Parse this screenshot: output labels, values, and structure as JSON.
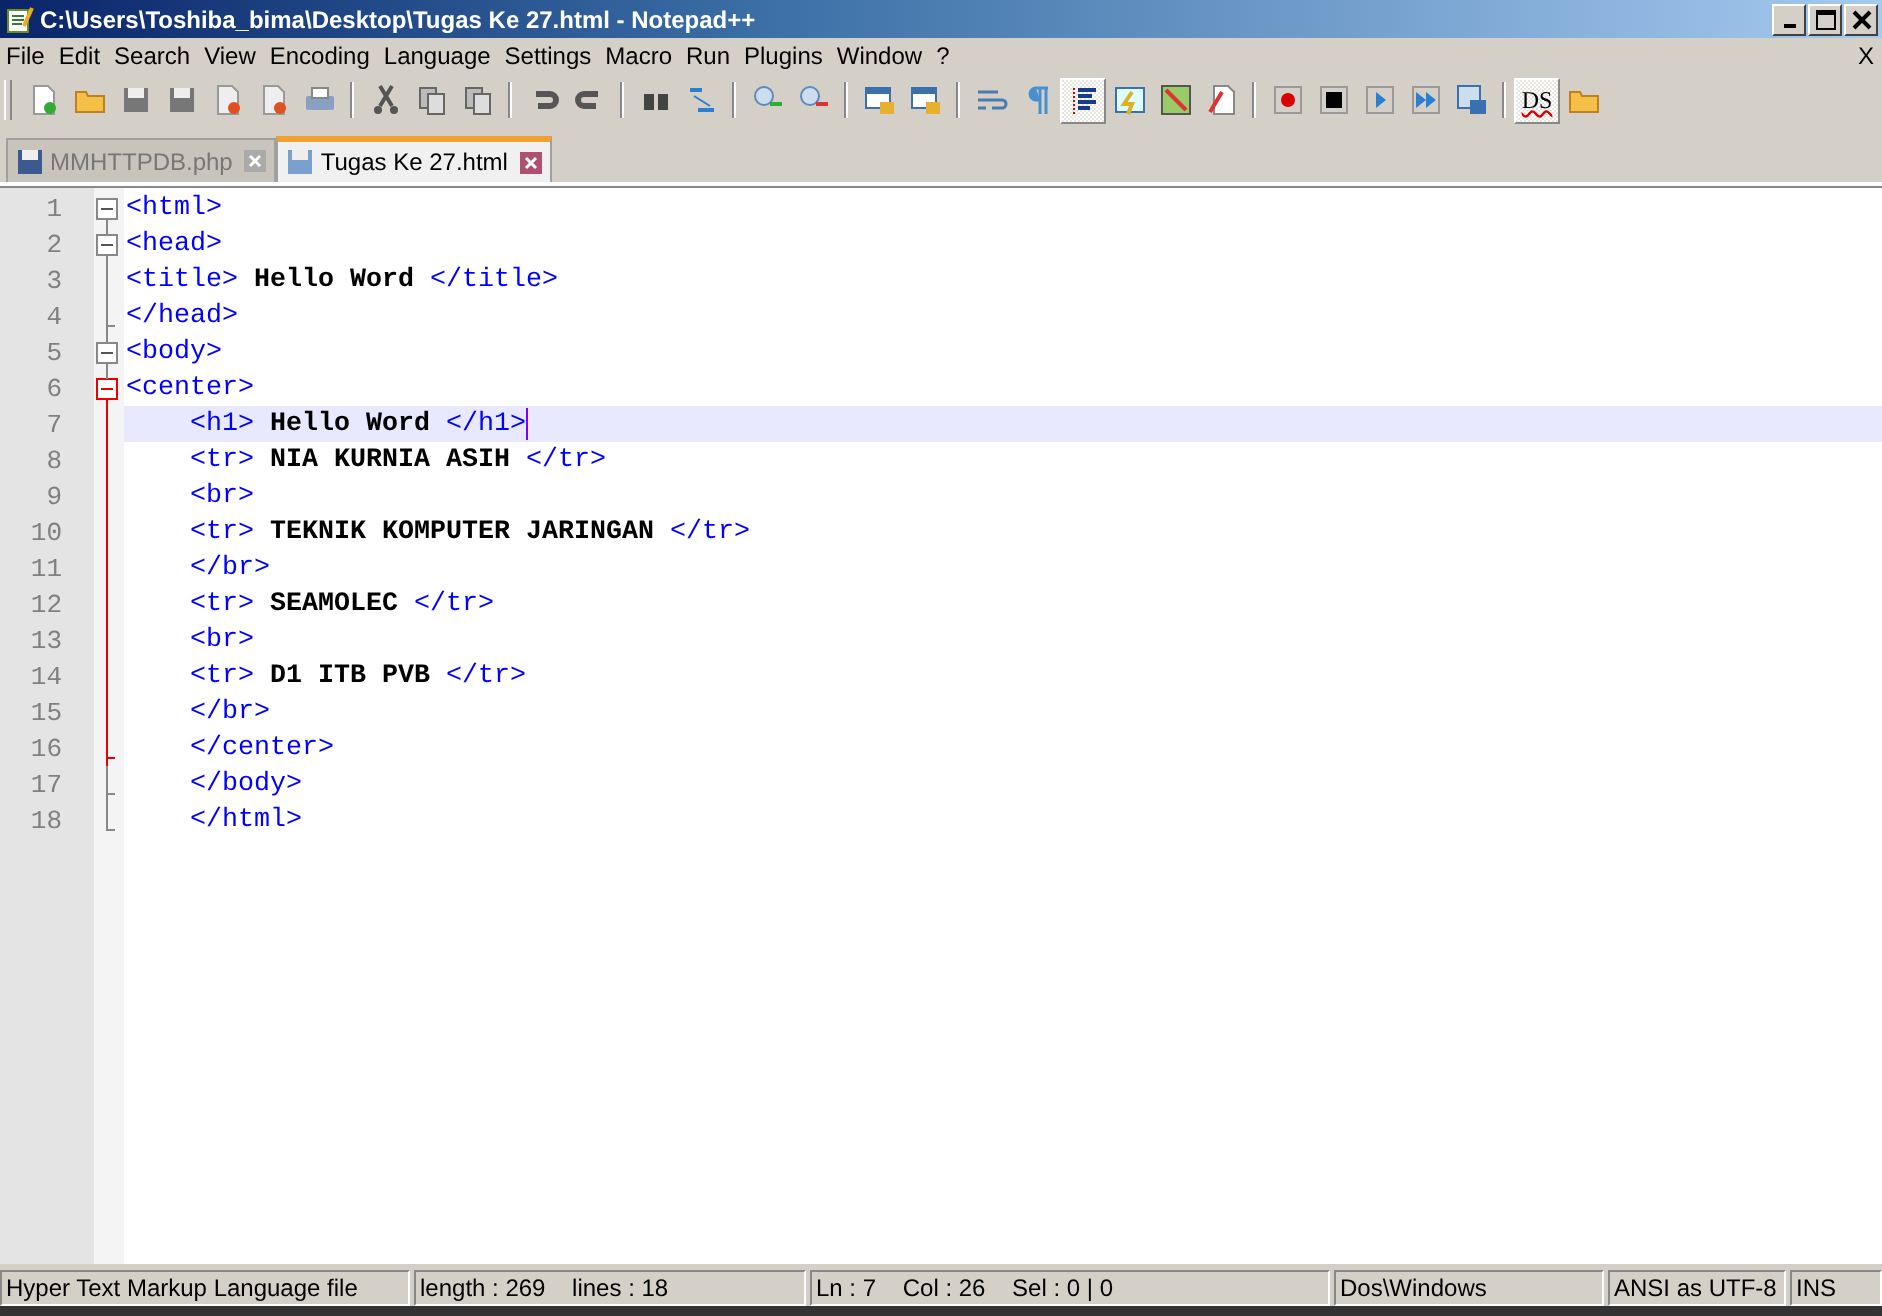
{
  "window": {
    "title": "C:\\Users\\Toshiba_bima\\Desktop\\Tugas Ke 27.html - Notepad++"
  },
  "menu": [
    "File",
    "Edit",
    "Search",
    "View",
    "Encoding",
    "Language",
    "Settings",
    "Macro",
    "Run",
    "Plugins",
    "Window",
    "?"
  ],
  "menu_close": "X",
  "toolbar": [
    {
      "kind": "new",
      "pressed": false
    },
    {
      "kind": "open",
      "pressed": false
    },
    {
      "kind": "save",
      "pressed": false
    },
    {
      "kind": "saveall",
      "pressed": false
    },
    {
      "kind": "close",
      "pressed": false
    },
    {
      "kind": "closeall",
      "pressed": false
    },
    {
      "kind": "print",
      "pressed": false
    },
    {
      "kind": "sep"
    },
    {
      "kind": "cut",
      "pressed": false
    },
    {
      "kind": "copy",
      "pressed": false
    },
    {
      "kind": "paste",
      "pressed": false
    },
    {
      "kind": "sep"
    },
    {
      "kind": "undo",
      "pressed": false
    },
    {
      "kind": "redo",
      "pressed": false
    },
    {
      "kind": "sep"
    },
    {
      "kind": "find",
      "pressed": false
    },
    {
      "kind": "replace",
      "pressed": false
    },
    {
      "kind": "sep"
    },
    {
      "kind": "zoomin",
      "pressed": false
    },
    {
      "kind": "zoomout",
      "pressed": false
    },
    {
      "kind": "sep"
    },
    {
      "kind": "syncv",
      "pressed": false
    },
    {
      "kind": "synch",
      "pressed": false
    },
    {
      "kind": "sep"
    },
    {
      "kind": "wrap",
      "pressed": false
    },
    {
      "kind": "pilcrow",
      "pressed": false
    },
    {
      "kind": "indent",
      "pressed": true
    },
    {
      "kind": "udl",
      "pressed": false
    },
    {
      "kind": "docmap",
      "pressed": false
    },
    {
      "kind": "function",
      "pressed": false
    },
    {
      "kind": "sep"
    },
    {
      "kind": "record",
      "pressed": false
    },
    {
      "kind": "stop",
      "pressed": false
    },
    {
      "kind": "play",
      "pressed": false
    },
    {
      "kind": "playmulti",
      "pressed": false
    },
    {
      "kind": "savemacro",
      "pressed": false
    },
    {
      "kind": "sep"
    },
    {
      "kind": "spell",
      "pressed": true,
      "label": "DS"
    },
    {
      "kind": "folder",
      "pressed": false
    }
  ],
  "tabs": [
    {
      "label": "MMHTTPDB.php",
      "selected": false
    },
    {
      "label": "Tugas Ke 27.html",
      "selected": true
    }
  ],
  "editor": {
    "lines": [
      {
        "number": "1",
        "indented": false,
        "kind": "fold_start",
        "red": false,
        "current": false,
        "segments": [
          {
            "kind": "tag",
            "text": "<html>"
          }
        ]
      },
      {
        "number": "2",
        "indented": false,
        "kind": "fold_start",
        "red": false,
        "current": false,
        "segments": [
          {
            "kind": "tag",
            "text": "<head>"
          }
        ]
      },
      {
        "number": "3",
        "indented": false,
        "kind": "fold_middle",
        "red": false,
        "current": false,
        "segments": [
          {
            "kind": "tag",
            "text": "<title>"
          },
          {
            "kind": "text",
            "text": " Hello Word "
          },
          {
            "kind": "tag",
            "text": "</title>"
          }
        ]
      },
      {
        "number": "4",
        "indented": false,
        "kind": "fold_end",
        "red": false,
        "current": false,
        "segments": [
          {
            "kind": "tag",
            "text": "</head>"
          }
        ]
      },
      {
        "number": "5",
        "indented": false,
        "kind": "fold_start",
        "red": false,
        "current": false,
        "segments": [
          {
            "kind": "tag",
            "text": "<body>"
          }
        ]
      },
      {
        "number": "6",
        "indented": false,
        "kind": "fold_start",
        "red": true,
        "current": false,
        "segments": [
          {
            "kind": "tag",
            "text": "<center>"
          }
        ]
      },
      {
        "number": "7",
        "indented": true,
        "kind": "fold_middle",
        "red": true,
        "current": true,
        "segments": [
          {
            "kind": "tag",
            "text": "<h1>"
          },
          {
            "kind": "text",
            "text": " Hello Word "
          },
          {
            "kind": "tag",
            "text": "</h1>"
          }
        ]
      },
      {
        "number": "8",
        "indented": true,
        "kind": "fold_middle",
        "red": true,
        "current": false,
        "segments": [
          {
            "kind": "tag",
            "text": "<tr>"
          },
          {
            "kind": "text",
            "text": " NIA KURNIA ASIH "
          },
          {
            "kind": "tag",
            "text": "</tr>"
          }
        ]
      },
      {
        "number": "9",
        "indented": true,
        "kind": "fold_middle",
        "red": true,
        "current": false,
        "segments": [
          {
            "kind": "tag",
            "text": "<br>"
          }
        ]
      },
      {
        "number": "10",
        "indented": true,
        "kind": "fold_middle",
        "red": true,
        "current": false,
        "segments": [
          {
            "kind": "tag",
            "text": "<tr>"
          },
          {
            "kind": "text",
            "text": " TEKNIK KOMPUTER JARINGAN "
          },
          {
            "kind": "tag",
            "text": "</tr>"
          }
        ]
      },
      {
        "number": "11",
        "indented": true,
        "kind": "fold_middle",
        "red": true,
        "current": false,
        "segments": [
          {
            "kind": "tag",
            "text": "</br>"
          }
        ]
      },
      {
        "number": "12",
        "indented": true,
        "kind": "fold_middle",
        "red": true,
        "current": false,
        "segments": [
          {
            "kind": "tag",
            "text": "<tr>"
          },
          {
            "kind": "text",
            "text": " SEAMOLEC "
          },
          {
            "kind": "tag",
            "text": "</tr>"
          }
        ]
      },
      {
        "number": "13",
        "indented": true,
        "kind": "fold_middle",
        "red": true,
        "current": false,
        "segments": [
          {
            "kind": "tag",
            "text": "<br>"
          }
        ]
      },
      {
        "number": "14",
        "indented": true,
        "kind": "fold_middle",
        "red": true,
        "current": false,
        "segments": [
          {
            "kind": "tag",
            "text": "<tr>"
          },
          {
            "kind": "text",
            "text": " D1 ITB PVB "
          },
          {
            "kind": "tag",
            "text": "</tr>"
          }
        ]
      },
      {
        "number": "15",
        "indented": true,
        "kind": "fold_middle",
        "red": true,
        "current": false,
        "segments": [
          {
            "kind": "tag",
            "text": "</br>"
          }
        ]
      },
      {
        "number": "16",
        "indented": true,
        "kind": "fold_end",
        "red": true,
        "current": false,
        "segments": [
          {
            "kind": "tag",
            "text": "</center>"
          }
        ]
      },
      {
        "number": "17",
        "indented": true,
        "kind": "fold_end",
        "red": false,
        "current": false,
        "segments": [
          {
            "kind": "tag",
            "text": "</body>"
          }
        ]
      },
      {
        "number": "18",
        "indented": true,
        "kind": "fold_last",
        "red": false,
        "current": false,
        "segments": [
          {
            "kind": "tag",
            "text": "</html>"
          }
        ]
      }
    ]
  },
  "status_bar": [
    "Hyper Text Markup Language file",
    "length : 269    lines : 18",
    "Ln : 7    Col : 26    Sel : 0 | 0",
    "Dos\\Windows",
    "ANSI as UTF-8",
    "INS"
  ]
}
